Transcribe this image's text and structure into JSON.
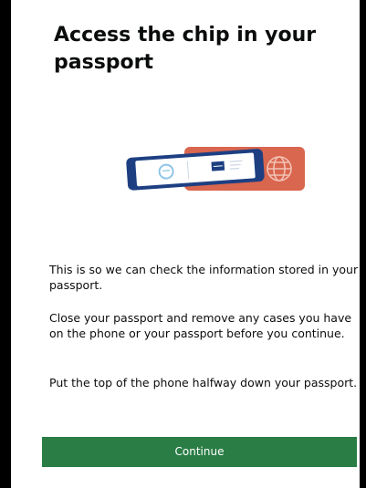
{
  "screen": {
    "title": "Access the chip in your passport",
    "paragraphs": [
      "This is so we can check the information stored in your passport.",
      "Close your passport and remove any cases you have on the phone or your passport before you continue.",
      "Put the top of the phone halfway down your passport."
    ],
    "illustration": {
      "icon": "phone-on-passport-illustration",
      "passport_color": "#d9664e",
      "phone_color": "#1d3f82"
    }
  },
  "actions": {
    "continue_label": "Continue",
    "continue_color": "#2a7d45"
  }
}
